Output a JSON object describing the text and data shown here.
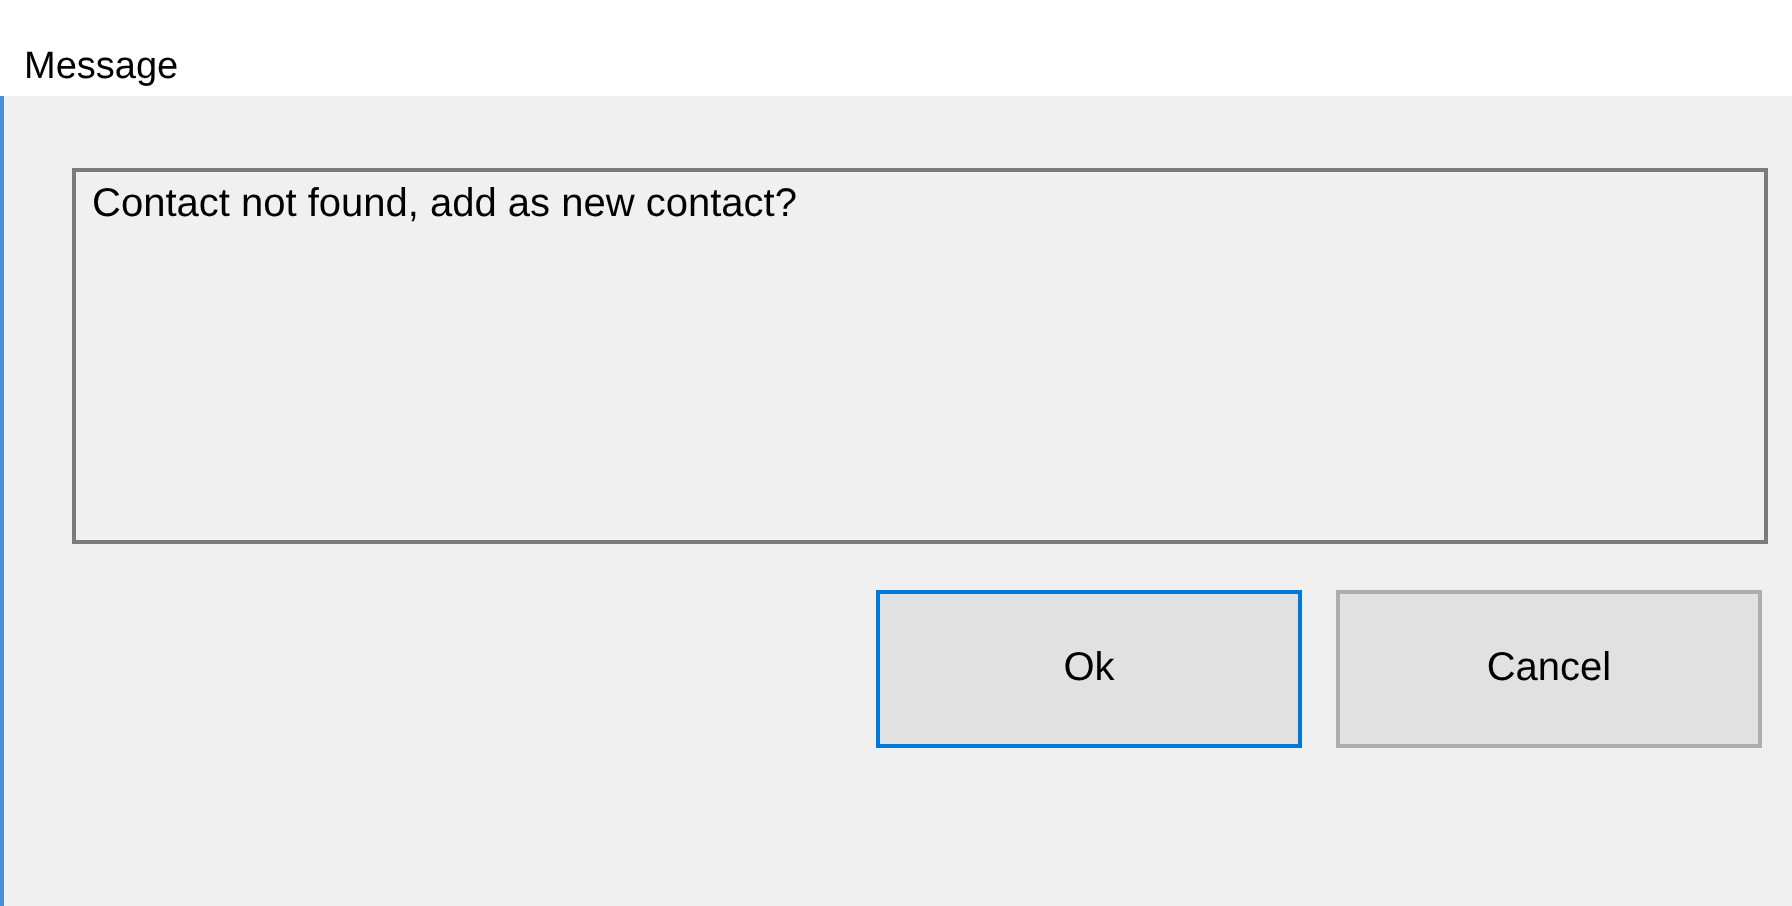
{
  "window": {
    "title": "Message"
  },
  "message": "Contact not found, add as new contact?",
  "buttons": [
    {
      "label": "Ok",
      "focused": true
    },
    {
      "label": "Cancel",
      "focused": false
    }
  ]
}
